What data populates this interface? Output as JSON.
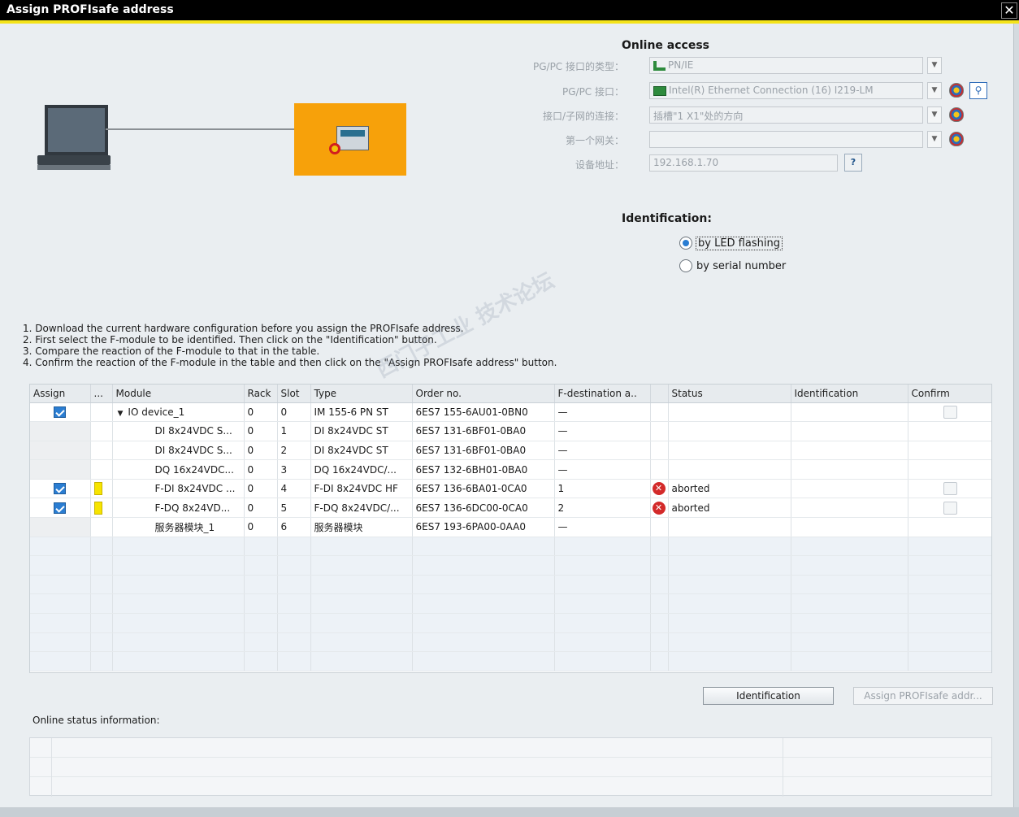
{
  "window": {
    "title": "Assign PROFIsafe address",
    "close_glyph": "✕"
  },
  "online_access": {
    "title": "Online access",
    "fields": [
      {
        "label": "PG/PC 接口的类型：",
        "value": "PN/IE"
      },
      {
        "label": "PG/PC 接口：",
        "value": "Intel(R) Ethernet Connection (16) I219-LM"
      },
      {
        "label": "接口/子网的连接：",
        "value": "插槽\"1 X1\"处的方向"
      },
      {
        "label": "第一个网关：",
        "value": ""
      },
      {
        "label": "设备地址：",
        "value": "192.168.1.70"
      }
    ],
    "address_help_glyph": "?"
  },
  "identification": {
    "title": "Identification:",
    "options": [
      {
        "label": "by LED flashing",
        "selected": true
      },
      {
        "label": "by serial number",
        "selected": false
      }
    ]
  },
  "instructions": [
    "1. Download the current hardware configuration before you assign the PROFIsafe address.",
    "2. First select the F-module to be identified. Then click on the \"Identification\" button.",
    "3. Compare the reaction of the F-module to that in the table.",
    "4. Confirm the reaction of the F-module in the table and then click on the \"Assign PROFIsafe address\" button."
  ],
  "table": {
    "headers": [
      "Assign",
      "...",
      "Module",
      "Rack",
      "Slot",
      "Type",
      "Order no.",
      "F-destination a..",
      "",
      "Status",
      "Identification",
      "Confirm"
    ],
    "rows": [
      {
        "assign": "checked",
        "marker": "",
        "expander": "▼",
        "module": "IO device_1",
        "rack": "0",
        "slot": "0",
        "type": "IM 155-6 PN ST",
        "order": "6ES7 155-6AU01-0BN0",
        "fdest": "—",
        "status_icon": "",
        "status": "",
        "confirm": true
      },
      {
        "assign": "",
        "marker": "",
        "expander": "",
        "module": "DI 8x24VDC S...",
        "rack": "0",
        "slot": "1",
        "type": "DI 8x24VDC ST",
        "order": "6ES7 131-6BF01-0BA0",
        "fdest": "—",
        "status_icon": "",
        "status": "",
        "confirm": false
      },
      {
        "assign": "",
        "marker": "",
        "expander": "",
        "module": "DI 8x24VDC S...",
        "rack": "0",
        "slot": "2",
        "type": "DI 8x24VDC ST",
        "order": "6ES7 131-6BF01-0BA0",
        "fdest": "—",
        "status_icon": "",
        "status": "",
        "confirm": false
      },
      {
        "assign": "",
        "marker": "",
        "expander": "",
        "module": "DQ 16x24VDC...",
        "rack": "0",
        "slot": "3",
        "type": "DQ 16x24VDC/...",
        "order": "6ES7 132-6BH01-0BA0",
        "fdest": "—",
        "status_icon": "",
        "status": "",
        "confirm": false
      },
      {
        "assign": "checked",
        "marker": "yellow",
        "expander": "",
        "module": "F-DI 8x24VDC ...",
        "rack": "0",
        "slot": "4",
        "type": "F-DI 8x24VDC HF",
        "order": "6ES7 136-6BA01-0CA0",
        "fdest": "1",
        "status_icon": "✕",
        "status": "aborted",
        "confirm": true
      },
      {
        "assign": "checked",
        "marker": "yellow",
        "expander": "",
        "module": "F-DQ 8x24VD...",
        "rack": "0",
        "slot": "5",
        "type": "F-DQ 8x24VDC/...",
        "order": "6ES7 136-6DC00-0CA0",
        "fdest": "2",
        "status_icon": "✕",
        "status": "aborted",
        "confirm": true
      },
      {
        "assign": "",
        "marker": "",
        "expander": "",
        "module": "服务器模块_1",
        "rack": "0",
        "slot": "6",
        "type": "服务器模块",
        "order": "6ES7 193-6PA00-0AA0",
        "fdest": "—",
        "status_icon": "",
        "status": "",
        "confirm": false
      }
    ]
  },
  "buttons": {
    "identification": "Identification",
    "assign": "Assign PROFIsafe addr..."
  },
  "online_status": {
    "label": "Online status information:"
  },
  "watermark": "西门子工业 技术论坛"
}
